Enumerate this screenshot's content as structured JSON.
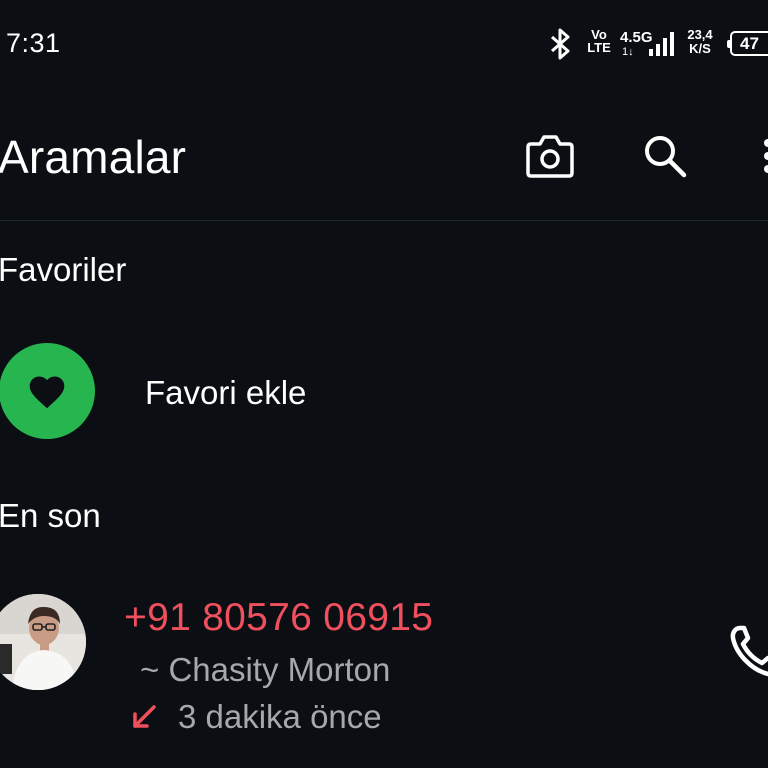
{
  "status_bar": {
    "time": "7:31",
    "bluetooth_icon": "bluetooth-icon",
    "volte_top": "Vo",
    "volte_bottom": "LTE",
    "network_type": "4.5G",
    "network_arrows": "1↓",
    "signal_icon": "signal-bars-icon",
    "speed_value": "23,4",
    "speed_unit": "K/S",
    "battery_level": "47"
  },
  "header": {
    "title": "Aramalar",
    "camera_icon": "camera-icon",
    "search_icon": "search-icon",
    "more_icon": "more-vert-icon"
  },
  "favorites": {
    "section_title": "Favoriler",
    "add_label": "Favori ekle",
    "add_icon": "heart-icon",
    "accent_color": "#27b550"
  },
  "recent": {
    "section_title": "En son",
    "calls": [
      {
        "number": "+91 80576 06915",
        "name": "~ Chasity Morton",
        "time": "3 dakika önce",
        "type_icon": "missed-call-arrow-icon",
        "number_color": "#f0505e",
        "action_icon": "phone-icon"
      }
    ]
  }
}
